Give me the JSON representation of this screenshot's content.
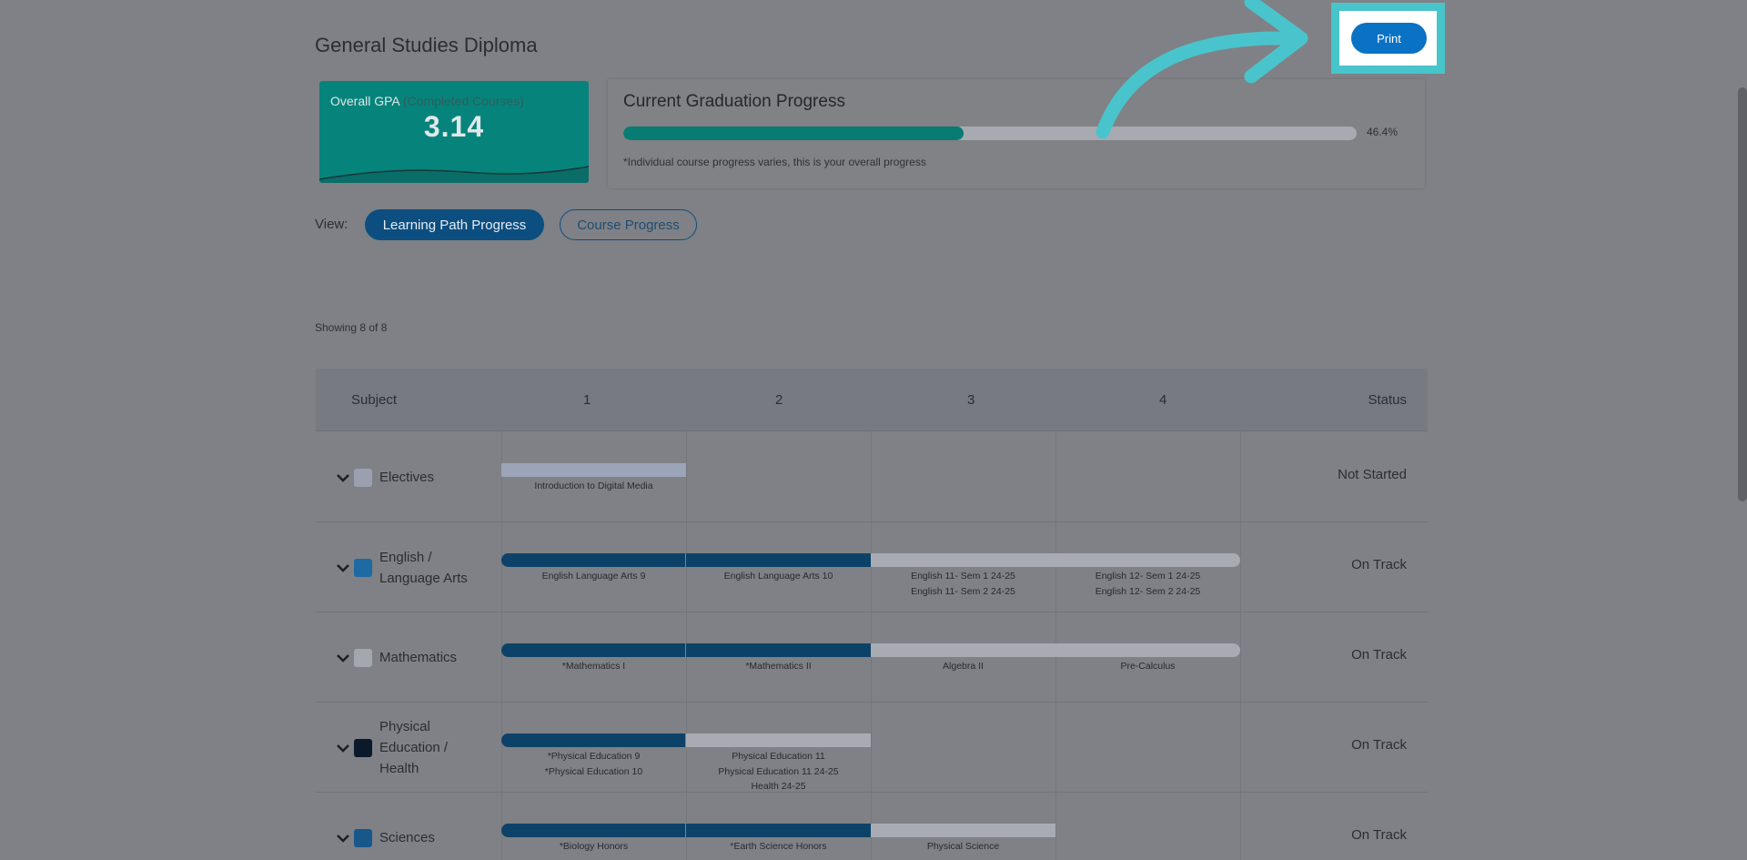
{
  "page": {
    "title": "General Studies Diploma"
  },
  "gpa": {
    "label": "Overall GPA",
    "sublabel": "(Completed Courses)",
    "value": "3.14"
  },
  "graduation": {
    "title": "Current Graduation Progress",
    "percent_label": "46.4%",
    "percent_value": 46.4,
    "note": "*Individual course progress varies, this is your overall progress"
  },
  "view": {
    "label": "View:",
    "learning_path_label": "Learning Path Progress",
    "course_progress_label": "Course Progress"
  },
  "showing": "Showing 8 of 8",
  "print": {
    "label": "Print"
  },
  "table": {
    "headers": [
      "Subject",
      "1",
      "2",
      "3",
      "4",
      "Status"
    ],
    "rows": [
      {
        "subject": "Electives",
        "subject_lines": [
          "Electives"
        ],
        "swatch": "#9ba0b0",
        "status": "Not Started",
        "cols": [
          [
            "Introduction to Digital Media"
          ],
          [],
          [],
          []
        ]
      },
      {
        "subject": "English / Language Arts",
        "subject_lines": [
          "English /",
          "Language Arts"
        ],
        "swatch": "#1e6aa3",
        "status": "On Track",
        "cols": [
          [
            "English Language Arts 9"
          ],
          [
            "English Language Arts 10"
          ],
          [
            "English 11- Sem 1 24-25",
            "English 11- Sem 2 24-25"
          ],
          [
            "English 12- Sem 1 24-25",
            "English 12- Sem 2 24-25"
          ]
        ]
      },
      {
        "subject": "Mathematics",
        "subject_lines": [
          "Mathematics"
        ],
        "swatch": "#a3a7ae",
        "status": "On Track",
        "cols": [
          [
            "*Mathematics I"
          ],
          [
            "*Mathematics II"
          ],
          [
            "Algebra II"
          ],
          [
            "Pre-Calculus"
          ]
        ]
      },
      {
        "subject": "Physical Education / Health",
        "subject_lines": [
          "Physical",
          "Education /",
          "Health"
        ],
        "swatch": "#0b1a2a",
        "status": "On Track",
        "cols": [
          [
            "*Physical Education 9",
            "*Physical Education 10"
          ],
          [
            "Physical Education 11",
            "Physical Education 11 24-25",
            "Health 24-25"
          ],
          [],
          []
        ]
      },
      {
        "subject": "Sciences",
        "subject_lines": [
          "Sciences"
        ],
        "swatch": "#18578a",
        "status": "On Track",
        "cols": [
          [
            "*Biology Honors"
          ],
          [
            "*Earth Science Honors"
          ],
          [
            "Physical Science"
          ],
          []
        ]
      }
    ]
  },
  "colors": {
    "accent_teal": "#06847b",
    "primary_blue": "#0d4e80",
    "print_blue": "#0a72c4",
    "highlight_cyan": "#48c4cb"
  }
}
